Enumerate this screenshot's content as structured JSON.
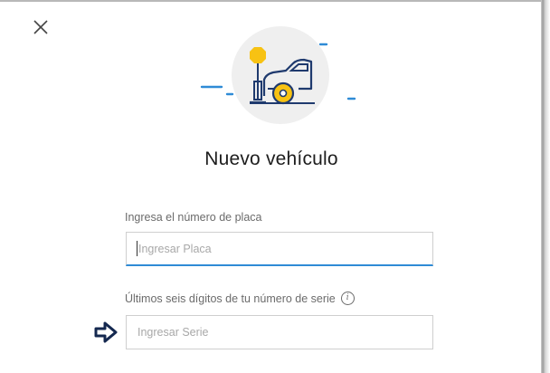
{
  "dialog": {
    "title": "Nuevo vehículo",
    "close_icon": "close-icon",
    "hero_icon": "car-parking-icon"
  },
  "plate": {
    "label": "Ingresa el número de placa",
    "placeholder": "Ingresar Placa",
    "value": ""
  },
  "serial": {
    "label": "Últimos seis dígitos de tu número de serie",
    "info_icon": "info-icon",
    "placeholder": "Ingresar Serie",
    "value": ""
  },
  "annotation": {
    "pointer_icon": "arrow-right-icon"
  },
  "colors": {
    "accent_blue": "#2f8bd6",
    "icon_navy": "#1f3a6e",
    "icon_yellow": "#f7c213",
    "hero_bg": "#efefef",
    "title_text": "#1d1d1d",
    "label_text": "#6b6b6b"
  }
}
